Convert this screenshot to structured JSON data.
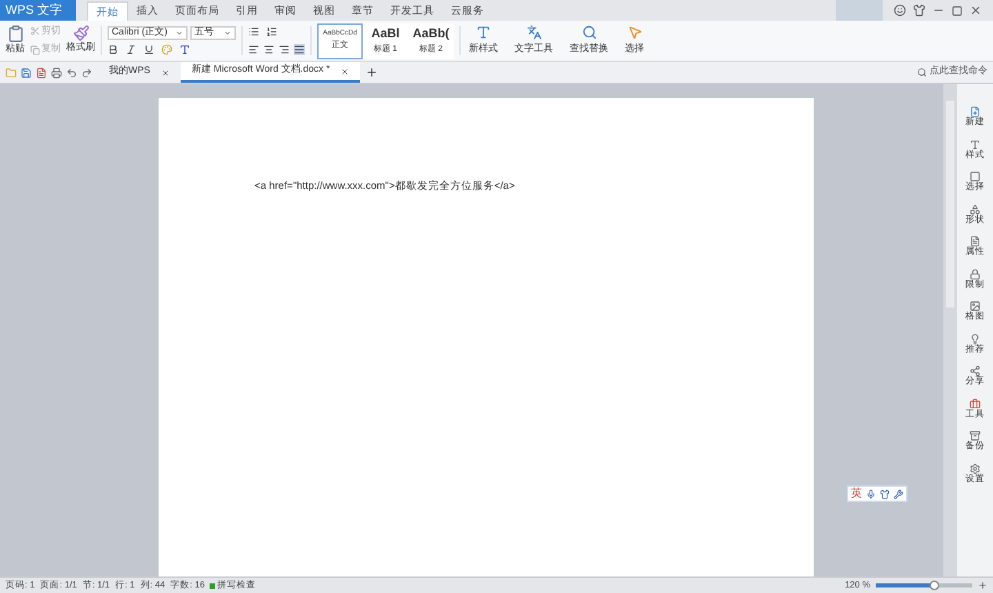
{
  "app_menu": "WPS 文字",
  "menu_tabs": [
    {
      "label": "开始",
      "selected": true
    },
    {
      "label": "插入",
      "selected": false
    },
    {
      "label": "页面布局",
      "selected": false
    },
    {
      "label": "引用",
      "selected": false
    },
    {
      "label": "审阅",
      "selected": false
    },
    {
      "label": "视图",
      "selected": false
    },
    {
      "label": "章节",
      "selected": false
    },
    {
      "label": "开发工具",
      "selected": false
    },
    {
      "label": "云服务",
      "selected": false
    }
  ],
  "ribbon": {
    "paste": "粘贴",
    "cut": {
      "label": "剪切",
      "disabled": true
    },
    "copy": {
      "label": "复制",
      "disabled": true
    },
    "format_painter": "格式刷",
    "font": "Calibri (正文)",
    "font_size": "五号",
    "styles": [
      {
        "preview": "AaBbCcDd",
        "label": "正文",
        "selected": true
      },
      {
        "preview": "AaBl",
        "label": "标题 1",
        "selected": false
      },
      {
        "preview": "AaBb(",
        "label": "标题 2",
        "selected": false
      }
    ],
    "tools": [
      "新样式",
      "文字工具",
      "查找替换",
      "选择"
    ]
  },
  "doc_tabs": [
    {
      "label": "我的WPS",
      "selected": false
    },
    {
      "label": "新建 Microsoft Word 文档.docx *",
      "selected": true
    }
  ],
  "search": {
    "placeholder": "点此查找命令"
  },
  "document": {
    "text": "<a href=\"http://www.xxx.com\">都歇发完全方位服务</a>"
  },
  "sidebar": [
    "新建",
    "样式",
    "选择",
    "形状",
    "属性",
    "限制",
    "格图",
    "推荐",
    "分享",
    "工具",
    "备份",
    "设置"
  ],
  "ime": {
    "label": "英"
  },
  "status": [
    "页码: 1",
    "页面: 1/1",
    "节: 1/1",
    "行: 1",
    "列: 44",
    "字数: 16"
  ],
  "spell_check": "拼写检查",
  "zoom": {
    "reading": "120 %",
    "level": 0.6
  }
}
